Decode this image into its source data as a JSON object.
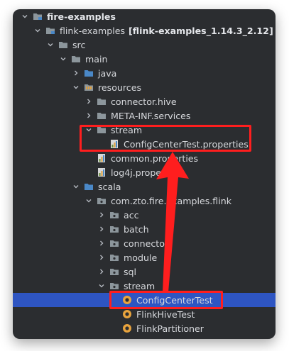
{
  "tree": {
    "items": [
      {
        "label": "fire-examples",
        "depth": 0,
        "expanded": true,
        "icon": "module-folder-icon",
        "bold": true
      },
      {
        "label": "flink-examples",
        "suffix": "[flink-examples_1.14.3_2.12]",
        "depth": 1,
        "expanded": true,
        "icon": "module-folder-icon"
      },
      {
        "label": "src",
        "depth": 2,
        "expanded": true,
        "icon": "folder-icon"
      },
      {
        "label": "main",
        "depth": 3,
        "expanded": true,
        "icon": "folder-icon"
      },
      {
        "label": "java",
        "depth": 4,
        "expanded": false,
        "icon": "source-folder-icon"
      },
      {
        "label": "resources",
        "depth": 4,
        "expanded": true,
        "icon": "resources-folder-icon"
      },
      {
        "label": "connector.hive",
        "depth": 5,
        "expanded": false,
        "icon": "folder-icon"
      },
      {
        "label": "META-INF.services",
        "depth": 5,
        "expanded": false,
        "icon": "folder-icon"
      },
      {
        "label": "stream",
        "depth": 5,
        "expanded": true,
        "icon": "folder-icon"
      },
      {
        "label": "ConfigCenterTest.properties",
        "depth": 6,
        "icon": "properties-file-icon"
      },
      {
        "label": "common.properties",
        "depth": 5,
        "icon": "properties-file-icon"
      },
      {
        "label": "log4j.properties",
        "depth": 5,
        "icon": "properties-file-icon"
      },
      {
        "label": "scala",
        "depth": 4,
        "expanded": true,
        "icon": "source-folder-icon"
      },
      {
        "label": "com.zto.fire.examples.flink",
        "depth": 5,
        "expanded": true,
        "icon": "package-icon"
      },
      {
        "label": "acc",
        "depth": 6,
        "expanded": false,
        "icon": "package-icon"
      },
      {
        "label": "batch",
        "depth": 6,
        "expanded": false,
        "icon": "package-icon"
      },
      {
        "label": "connector",
        "depth": 6,
        "expanded": false,
        "icon": "package-icon"
      },
      {
        "label": "module",
        "depth": 6,
        "expanded": false,
        "icon": "package-icon"
      },
      {
        "label": "sql",
        "depth": 6,
        "expanded": false,
        "icon": "package-icon"
      },
      {
        "label": "stream",
        "depth": 6,
        "expanded": true,
        "icon": "package-icon"
      },
      {
        "label": "ConfigCenterTest",
        "depth": 7,
        "icon": "scala-object-icon",
        "selected": true
      },
      {
        "label": "FlinkHiveTest",
        "depth": 7,
        "icon": "scala-object-icon"
      },
      {
        "label": "FlinkPartitioner",
        "depth": 7,
        "icon": "scala-object-icon"
      }
    ]
  },
  "colors": {
    "background": "#2b2d30",
    "selection": "#2e55c2",
    "annotation": "#ff1e1e",
    "folder": "#87939a",
    "source_folder": "#4a88c7",
    "scala_object": "#e8a33d"
  }
}
